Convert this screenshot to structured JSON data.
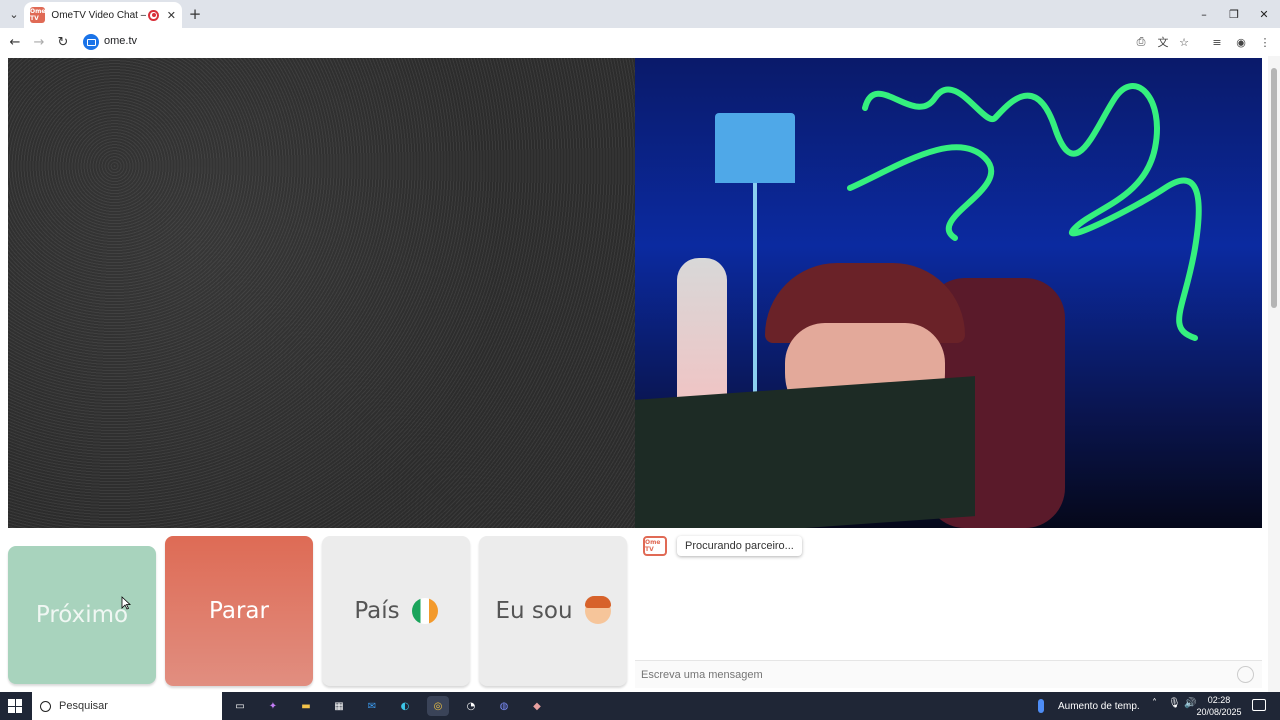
{
  "browser": {
    "tab_title": "OmeTV Video Chat — Ome",
    "favicon_text": "Ome TV",
    "tab_close": "✕",
    "new_tab": "+",
    "url": "ome.tv",
    "window_controls": [
      "–",
      "❐",
      "✕"
    ]
  },
  "controls": {
    "next_label": "Próximo",
    "stop_label": "Parar",
    "country_label": "País",
    "iam_label": "Eu sou"
  },
  "chat": {
    "logo_text": "Ome TV",
    "status_message": "Procurando parceiro...",
    "input_placeholder": "Escreva uma mensagem"
  },
  "taskbar": {
    "search_placeholder": "Pesquisar",
    "weather_text": "Aumento de temp.",
    "time": "02:28",
    "date": "20/08/2025"
  },
  "colors": {
    "next_button": "#a8d3bd",
    "stop_button": "#de6b55",
    "neutral_button": "#ececec",
    "accent": "#e06a55"
  }
}
